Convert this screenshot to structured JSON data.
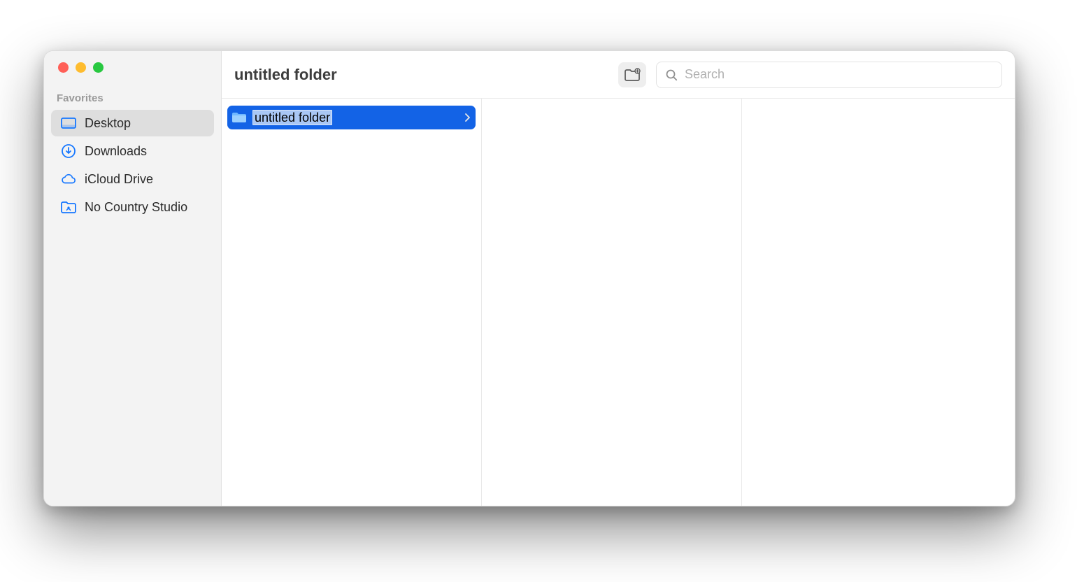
{
  "window": {
    "title": "untitled folder"
  },
  "toolbar": {
    "search_placeholder": "Search"
  },
  "sidebar": {
    "section_label": "Favorites",
    "items": [
      {
        "id": "desktop",
        "label": "Desktop",
        "icon": "desktop-icon",
        "active": true
      },
      {
        "id": "downloads",
        "label": "Downloads",
        "icon": "download-icon",
        "active": false
      },
      {
        "id": "icloud",
        "label": "iCloud Drive",
        "icon": "cloud-icon",
        "active": false
      },
      {
        "id": "studio",
        "label": "No Country Studio",
        "icon": "shared-folder-icon",
        "active": false
      }
    ]
  },
  "columns": [
    {
      "items": [
        {
          "name": "untitled folder",
          "kind": "folder",
          "selected": true,
          "editing": true
        }
      ]
    },
    {
      "items": []
    },
    {
      "items": []
    }
  ],
  "colors": {
    "accent": "#1363e6",
    "sidebar_bg": "#f3f3f3",
    "selected_edit_bg": "#a9c7f5"
  }
}
